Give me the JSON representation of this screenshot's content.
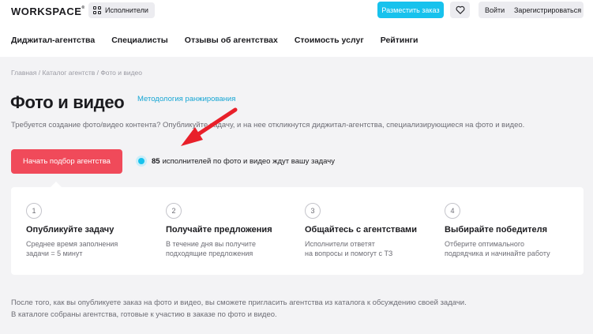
{
  "header": {
    "logo": "WORKSPACE",
    "logo_mark": "®",
    "performers_label": "Исполнители",
    "order_label": "Разместить заказ",
    "login_label": "Войти",
    "register_label": "Зарегистрироваться",
    "accent_color": "#17c2ed"
  },
  "nav": {
    "items": [
      "Диджитал-агентства",
      "Специалисты",
      "Отзывы об агентствах",
      "Стоимость услуг",
      "Рейтинги"
    ]
  },
  "breadcrumb": {
    "items": [
      "Главная",
      "Каталог агентств",
      "Фото и видео"
    ],
    "separator": " / "
  },
  "page": {
    "title": "Фото и видео",
    "methodology_link": "Методология ранжирования",
    "subtitle": "Требуется создание фото/видео контента? Опубликуйте задачу, и на нее откликнутся диджитал-агентства, специализирующиеся на фото и видео.",
    "start_button": "Начать подбор агентства",
    "start_button_color": "#f04a5a",
    "counter_value": "85",
    "counter_text": "исполнителей по фото и видео ждут вашу задачу"
  },
  "steps": [
    {
      "num": "1",
      "title": "Опубликуйте задачу",
      "desc_line1": "Среднее время заполнения",
      "desc_line2": "задачи = 5 минут"
    },
    {
      "num": "2",
      "title": "Получайте предложения",
      "desc_line1": "В течение дня вы получите",
      "desc_line2": "подходящие предложения"
    },
    {
      "num": "3",
      "title": "Общайтесь с агентствами",
      "desc_line1": "Исполнители ответят",
      "desc_line2": "на вопросы и помогут с ТЗ"
    },
    {
      "num": "4",
      "title": "Выбирайте победителя",
      "desc_line1": "Отберите оптимального",
      "desc_line2": "подрядчика и начинайте работу"
    }
  ],
  "bottom": {
    "line1": "После того, как вы опубликуете заказ на фото и видео, вы сможете пригласить агентства из каталога к обсуждению своей задачи.",
    "line2": "В каталоге собраны агентства, готовые к участию в заказе по фото и видео."
  },
  "annotation": {
    "arrow_color": "#e8202a"
  }
}
